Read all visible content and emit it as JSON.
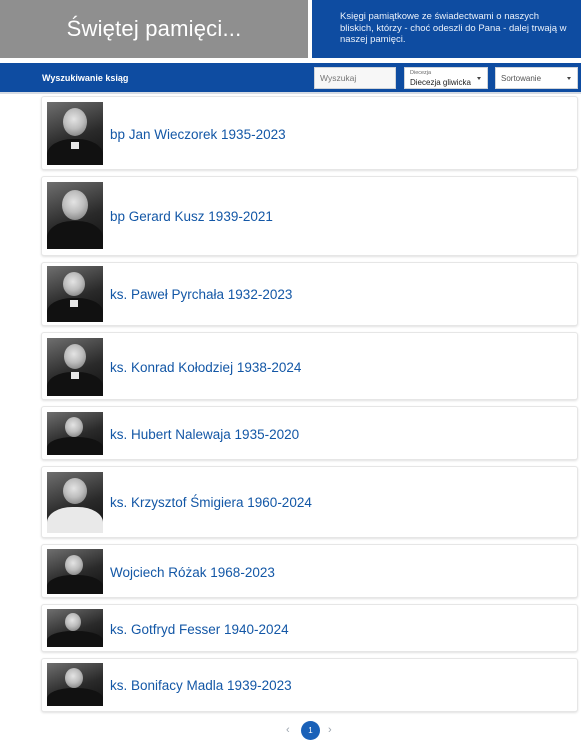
{
  "banner": {
    "title": "Świętej pamięci...",
    "description": "Księgi pamiątkowe ze świadectwami o naszych bliskich, którzy - choć odeszli do Pana - dalej trwają w naszej pamięci."
  },
  "toolbar": {
    "label": "Wyszukiwanie ksiąg",
    "search": {
      "placeholder": "Wyszukaj",
      "value": ""
    },
    "diecezja": {
      "label": "Diecezja",
      "value": "Diecezja gliwicka"
    },
    "sort": {
      "value": "Sortowanie"
    }
  },
  "books": [
    {
      "name": "bp Jan Wieczorek 1935-2023"
    },
    {
      "name": "bp Gerard Kusz 1939-2021"
    },
    {
      "name": "ks. Paweł Pyrchała 1932-2023"
    },
    {
      "name": "ks. Konrad Kołodziej 1938-2024"
    },
    {
      "name": "ks. Hubert Nalewaja 1935-2020"
    },
    {
      "name": "ks. Krzysztof Śmigiera 1960-2024"
    },
    {
      "name": "Wojciech Różak 1968-2023"
    },
    {
      "name": "ks. Gotfryd Fesser 1940-2024"
    },
    {
      "name": "ks. Bonifacy Madla 1939-2023"
    }
  ],
  "pagination": {
    "prev": "‹",
    "current": "1",
    "next": "›"
  },
  "colors": {
    "brand_blue": "#0e4ca1",
    "banner_gray": "#8f8f8f",
    "link_blue": "#1357a6"
  }
}
